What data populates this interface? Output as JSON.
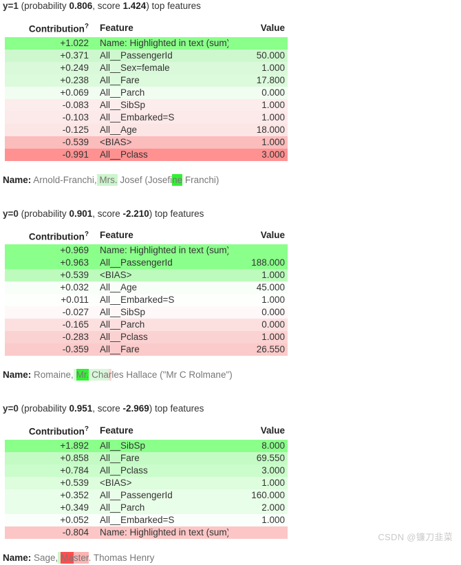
{
  "watermark": "CSDN @镰刀韭菜",
  "table_headers": {
    "contribution": "Contribution",
    "contribution_sup": "?",
    "feature": "Feature",
    "value": "Value"
  },
  "name_label": "Name:",
  "colors": {
    "green_strong": "#8aff8a",
    "green_mid": "#c6ffc6",
    "green_light": "#ddffdd",
    "green_faint": "#effdf0",
    "green_palest": "#f8fff8",
    "red_faint": "#fdf1f1",
    "red_light": "#fce4e4",
    "red_mid": "#fbc6c6",
    "red_strong": "#ff9191",
    "highlight_green_strong": "#33f033",
    "highlight_green_light": "#ccf5cc",
    "highlight_red_strong": "#ff6b6b",
    "highlight_red_light": "#fcd6d6",
    "text": "#333333",
    "muted_text": "#777777",
    "watermark": "#c9c9c9"
  },
  "sections": [
    {
      "heading": {
        "y_label": "y=1",
        "prefix": " (probability ",
        "probability": "0.806",
        "mid": ", score ",
        "score": "1.424",
        "suffix": ") top features"
      },
      "rows": [
        {
          "contribution": "+1.022",
          "feature": "Name: Highlighted in text (sum)",
          "value": "",
          "bg": "#8aff8a"
        },
        {
          "contribution": "+0.371",
          "feature": "All__PassengerId",
          "value": "50.000",
          "bg": "#cdf8cd"
        },
        {
          "contribution": "+0.249",
          "feature": "All__Sex=female",
          "value": "1.000",
          "bg": "#daf9da"
        },
        {
          "contribution": "+0.238",
          "feature": "All__Fare",
          "value": "17.800",
          "bg": "#dcfadc"
        },
        {
          "contribution": "+0.069",
          "feature": "All__Parch",
          "value": "0.000",
          "bg": "#f1fdf1"
        },
        {
          "contribution": "-0.083",
          "feature": "All__SibSp",
          "value": "1.000",
          "bg": "#fdecec"
        },
        {
          "contribution": "-0.103",
          "feature": "All__Embarked=S",
          "value": "1.000",
          "bg": "#fce9e9"
        },
        {
          "contribution": "-0.125",
          "feature": "All__Age",
          "value": "18.000",
          "bg": "#fce5e5"
        },
        {
          "contribution": "-0.539",
          "feature": "<BIAS>",
          "value": "1.000",
          "bg": "#fbbcbc"
        },
        {
          "contribution": "-0.991",
          "feature": "All__Pclass",
          "value": "3.000",
          "bg": "#ff9191"
        }
      ],
      "name_segments": [
        {
          "text": "Arnold-Franchi,",
          "bg": "none"
        },
        {
          "text": " Mrs.",
          "bg": "#ccf5cc"
        },
        {
          "text": " Josef (Josefi",
          "bg": "none"
        },
        {
          "text": "ne",
          "bg": "#33f033"
        },
        {
          "text": " Franchi)",
          "bg": "none"
        }
      ]
    },
    {
      "heading": {
        "y_label": "y=0",
        "prefix": " (probability ",
        "probability": "0.901",
        "mid": ", score ",
        "score": "-2.210",
        "suffix": ") top features"
      },
      "rows": [
        {
          "contribution": "+0.969",
          "feature": "Name: Highlighted in text (sum)",
          "value": "",
          "bg": "#8aff8a"
        },
        {
          "contribution": "+0.963",
          "feature": "All__PassengerId",
          "value": "188.000",
          "bg": "#8bff8b"
        },
        {
          "contribution": "+0.539",
          "feature": "<BIAS>",
          "value": "1.000",
          "bg": "#bcfbbc"
        },
        {
          "contribution": "+0.032",
          "feature": "All__Age",
          "value": "45.000",
          "bg": "#f8fef8"
        },
        {
          "contribution": "+0.011",
          "feature": "All__Embarked=S",
          "value": "1.000",
          "bg": "#fdfffd"
        },
        {
          "contribution": "-0.027",
          "feature": "All__SibSp",
          "value": "0.000",
          "bg": "#fef8f8"
        },
        {
          "contribution": "-0.165",
          "feature": "All__Parch",
          "value": "0.000",
          "bg": "#fce0e0"
        },
        {
          "contribution": "-0.283",
          "feature": "All__Pclass",
          "value": "1.000",
          "bg": "#fbd2d2"
        },
        {
          "contribution": "-0.359",
          "feature": "All__Fare",
          "value": "26.550",
          "bg": "#fbcaca"
        }
      ],
      "name_segments": [
        {
          "text": "Romaine,",
          "bg": "none"
        },
        {
          "text": " ",
          "bg": "#d9f7d9"
        },
        {
          "text": "Mr.",
          "bg": "#33f033"
        },
        {
          "text": " Cha",
          "bg": "#d9f7d9"
        },
        {
          "text": "r",
          "bg": "#fcd6d6"
        },
        {
          "text": "les Hallace (\"Mr C Rolmane\")",
          "bg": "none"
        }
      ]
    },
    {
      "heading": {
        "y_label": "y=0",
        "prefix": " (probability ",
        "probability": "0.951",
        "mid": ", score ",
        "score": "-2.969",
        "suffix": ") top features"
      },
      "rows": [
        {
          "contribution": "+1.892",
          "feature": "All__SibSp",
          "value": "8.000",
          "bg": "#8aff8a"
        },
        {
          "contribution": "+0.858",
          "feature": "All__Fare",
          "value": "69.550",
          "bg": "#c4fbc4"
        },
        {
          "contribution": "+0.784",
          "feature": "All__Pclass",
          "value": "3.000",
          "bg": "#cbfccb"
        },
        {
          "contribution": "+0.539",
          "feature": "<BIAS>",
          "value": "1.000",
          "bg": "#ddfddd"
        },
        {
          "contribution": "+0.352",
          "feature": "All__PassengerId",
          "value": "160.000",
          "bg": "#e9fee9"
        },
        {
          "contribution": "+0.349",
          "feature": "All__Parch",
          "value": "2.000",
          "bg": "#e9fee9"
        },
        {
          "contribution": "+0.052",
          "feature": "All__Embarked=S",
          "value": "1.000",
          "bg": "#fbfffb"
        },
        {
          "contribution": "-0.804",
          "feature": "Name: Highlighted in text (sum)",
          "value": "",
          "bg": "#fcc6c6"
        }
      ],
      "name_segments": [
        {
          "text": "Sage,",
          "bg": "none"
        },
        {
          "text": " ",
          "bg": "#ccf5cc"
        },
        {
          "text": "Ma",
          "bg": "#ff4d4d"
        },
        {
          "text": "ster",
          "bg": "#fcb3b3"
        },
        {
          "text": ". Thomas Henry",
          "bg": "none"
        }
      ]
    }
  ]
}
